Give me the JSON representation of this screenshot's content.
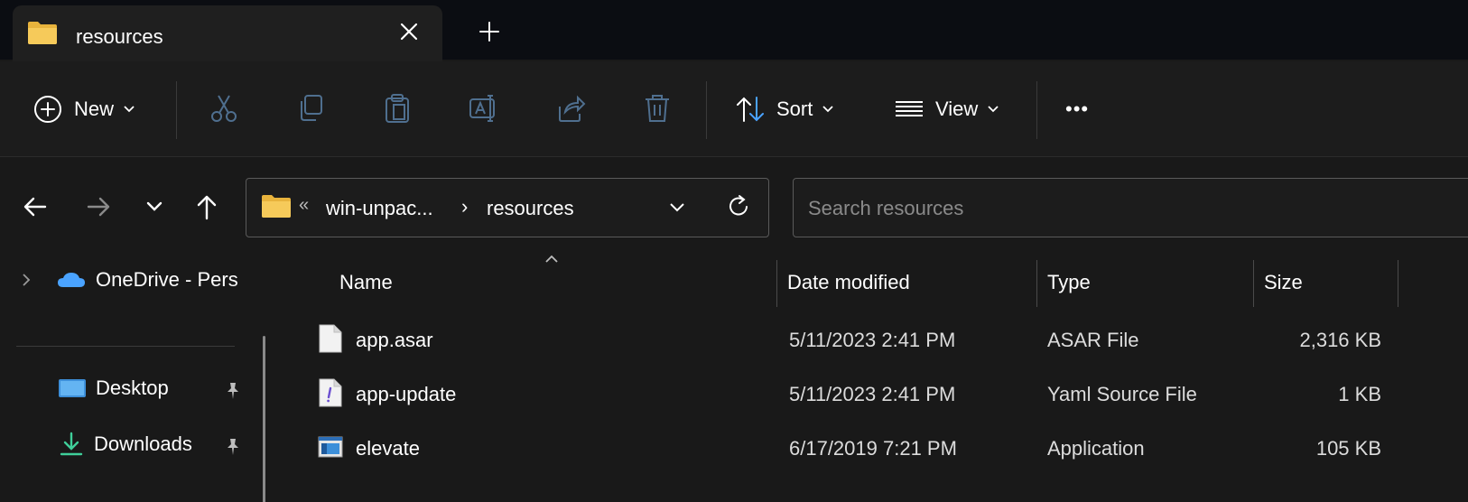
{
  "tab": {
    "title": "resources"
  },
  "toolbar": {
    "new_label": "New",
    "sort_label": "Sort",
    "view_label": "View",
    "more_label": "•••"
  },
  "address": {
    "overflow": "«",
    "crumb1": "win-unpac...",
    "separator": "›",
    "crumb2": "resources"
  },
  "search": {
    "placeholder": "Search resources"
  },
  "navpane": {
    "onedrive": "OneDrive - Pers",
    "desktop": "Desktop",
    "downloads": "Downloads"
  },
  "columns": {
    "name": "Name",
    "date": "Date modified",
    "type": "Type",
    "size": "Size"
  },
  "files": [
    {
      "name": "app.asar",
      "date": "5/11/2023 2:41 PM",
      "type": "ASAR File",
      "size": "2,316 KB",
      "icon": "document-icon"
    },
    {
      "name": "app-update",
      "date": "5/11/2023 2:41 PM",
      "type": "Yaml Source File",
      "size": "1 KB",
      "icon": "yaml-file-icon"
    },
    {
      "name": "elevate",
      "date": "6/17/2019 7:21 PM",
      "type": "Application",
      "size": "105 KB",
      "icon": "application-icon"
    }
  ],
  "colors": {
    "titlebar": "#0b0d12",
    "tab": "#1f1f1f",
    "background": "#191919",
    "folder": "#f3c44a",
    "accent_blue": "#4aa3ff"
  }
}
